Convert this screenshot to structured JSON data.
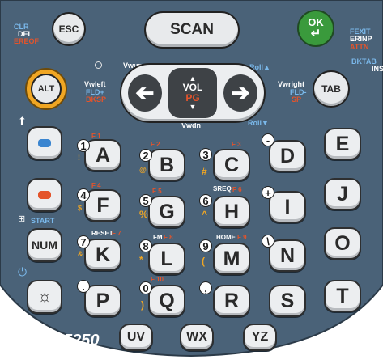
{
  "top": {
    "esc": "ESC",
    "scan": "SCAN",
    "ok": "OK",
    "clr": "CLR",
    "del": "DEL",
    "ereof": "EREOF",
    "fexit": "FEXIT",
    "erinp": "ERINP",
    "attn": "ATTN",
    "bktab": "BKTAB",
    "ins": "INS"
  },
  "nav": {
    "alt": "ALT",
    "tab": "TAB",
    "vwup": "Vwup",
    "vwdn": "Vwdn",
    "vwleft": "Vwleft",
    "vwright": "Vwright",
    "fld_plus": "FLD+",
    "fld_minus": "FLD-",
    "bksp": "BKSP",
    "sp": "SP",
    "roll_up": "Roll",
    "roll_dn": "Roll",
    "vol": "VOL",
    "pg": "PG"
  },
  "left": {
    "num": "NUM",
    "start": "START"
  },
  "keys": {
    "A": "A",
    "B": "B",
    "C": "C",
    "D": "D",
    "E": "E",
    "F": "F",
    "G": "G",
    "H": "H",
    "I": "I",
    "J": "J",
    "K": "K",
    "L": "L",
    "M": "M",
    "N": "N",
    "O": "O",
    "P": "P",
    "Q": "Q",
    "R": "R",
    "S": "S",
    "T": "T",
    "UV": "UV",
    "WX": "WX",
    "YZ": "YZ"
  },
  "numbers": {
    "n1": "1",
    "n2": "2",
    "n3": "3",
    "n4": "4",
    "n5": "5",
    "n6": "6",
    "n7": "7",
    "n8": "8",
    "n9": "9",
    "n0": "0"
  },
  "symbols": {
    "excl": "!",
    "at": "@",
    "hash": "#",
    "dollar": "$",
    "pct": "%",
    "caret": "^",
    "amp": "&",
    "star": "*",
    "paren_l": "(",
    "paren_r": ")",
    "minus": "-",
    "plus": "+",
    "backslash": "\\",
    "dot": ".",
    "comma": ","
  },
  "fkeys": {
    "f1": "F 1",
    "f2": "F 2",
    "f3": "F 3",
    "f4": "F 4",
    "f5": "F 5",
    "f6": "F 6",
    "f7": "F 7",
    "f8": "F 8",
    "f9": "F 9",
    "f10": "F 10"
  },
  "labels": {
    "sreq": "SREQ",
    "reset": "RESET",
    "fm": "FM",
    "home": "HOME"
  },
  "model": "5250",
  "colors": {
    "body": "#4a6278",
    "alt_ring": "#f0a623",
    "ok_green": "#3a9a3c",
    "fn_red": "#e4542b",
    "blue_label": "#7ab8ea"
  }
}
